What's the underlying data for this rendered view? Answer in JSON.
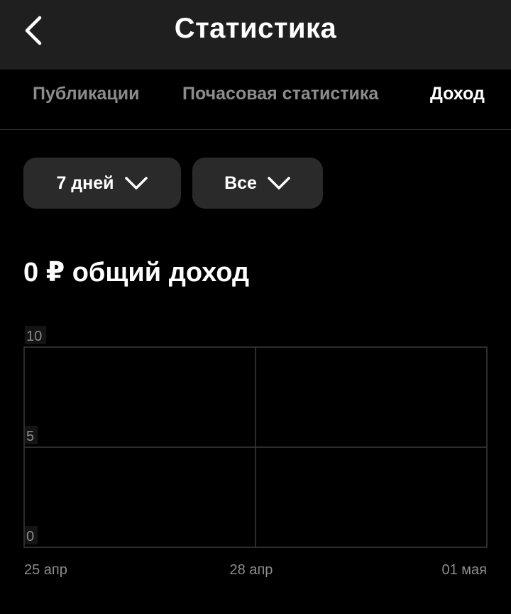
{
  "header": {
    "title": "Статистика",
    "back_icon": "chevron-left-icon"
  },
  "tabs": [
    {
      "label": "Публикации",
      "active": false
    },
    {
      "label": "Почасовая статистика",
      "active": false
    },
    {
      "label": "Доход",
      "active": true
    }
  ],
  "filters": {
    "period": {
      "label": "7 дней",
      "icon": "chevron-down-icon"
    },
    "type": {
      "label": "Все",
      "icon": "chevron-down-icon"
    }
  },
  "summary": {
    "total_text": "0 ₽ общий доход"
  },
  "colors": {
    "background": "#000000",
    "header_bg": "#1f1f1f",
    "chip_bg": "#2a2a2a",
    "text_primary": "#ffffff",
    "text_muted": "#8c8c8c",
    "grid": "#3a3a3a"
  },
  "chart_data": {
    "type": "line",
    "x": [
      "25 апр",
      "28 апр",
      "01 мая"
    ],
    "y_ticks": [
      10,
      5,
      0
    ],
    "ylim": [
      0,
      10
    ],
    "series": [],
    "grid": true,
    "title": "",
    "xlabel": "",
    "ylabel": ""
  }
}
